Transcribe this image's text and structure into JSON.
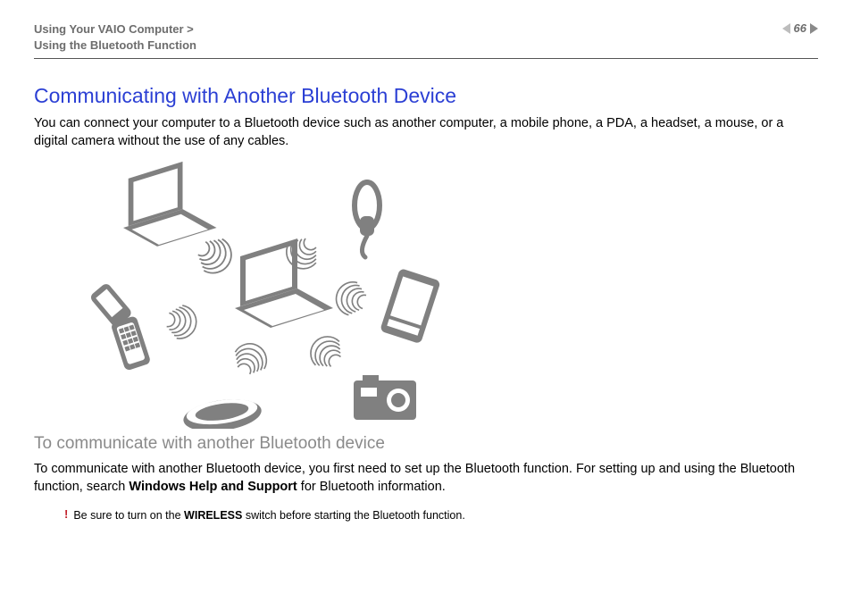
{
  "header": {
    "breadcrumb_line1": "Using Your VAIO Computer >",
    "breadcrumb_line2": "Using the Bluetooth Function",
    "page_number": "66"
  },
  "main": {
    "title": "Communicating with Another Bluetooth Device",
    "intro": "You can connect your computer to a Bluetooth device such as another computer, a mobile phone, a PDA, a headset, a mouse, or a digital camera without the use of any cables.",
    "subtitle": "To communicate with another Bluetooth device",
    "para2_a": "To communicate with another Bluetooth device, you first need to set up the Bluetooth function. For setting up and using the Bluetooth function, search ",
    "para2_bold": "Windows Help and Support",
    "para2_b": " for Bluetooth information.",
    "note_bang": "!",
    "note_a": "Be sure to turn on the ",
    "note_bold": "WIRELESS",
    "note_b": " switch before starting the Bluetooth function."
  }
}
